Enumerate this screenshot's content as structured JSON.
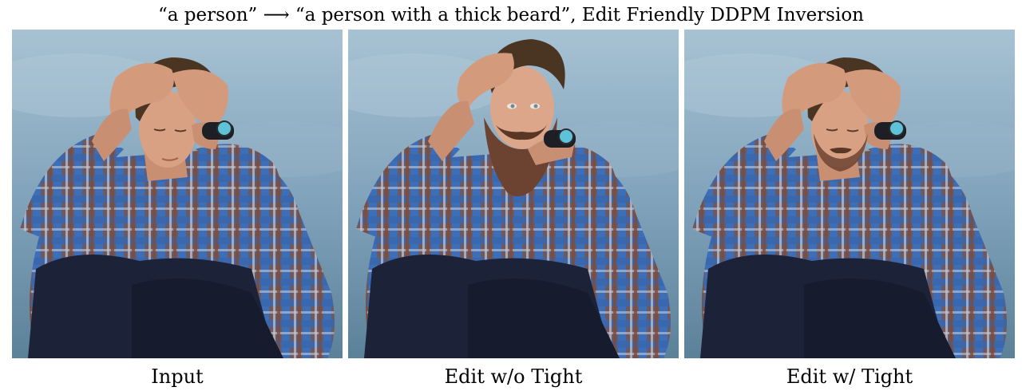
{
  "figure": {
    "title": "“a person” ⟶ “a person with a thick beard”, Edit Friendly DDPM Inversion",
    "panels": [
      {
        "caption": "Input",
        "beard": "none"
      },
      {
        "caption": "Edit w/o Tight",
        "beard": "thick"
      },
      {
        "caption": "Edit w/ Tight",
        "beard": "light"
      }
    ]
  },
  "colors": {
    "sky_top": "#9bb8cc",
    "sky_bottom": "#5f87a3",
    "shirt_blue": "#3d6fb8",
    "shirt_brown": "#7a5648",
    "pants": "#1c2238",
    "skin": "#d9a184",
    "hair": "#4a3422",
    "beard": "#6b4330",
    "watch_face": "#5ec3d8"
  }
}
